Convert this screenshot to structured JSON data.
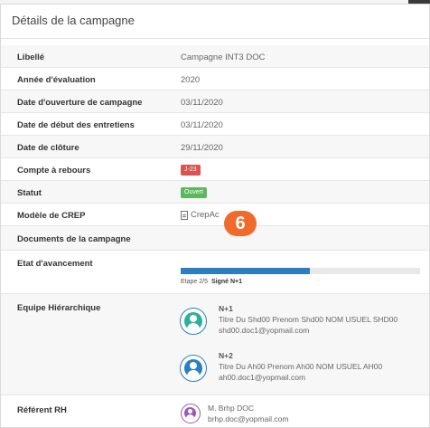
{
  "panel": {
    "title": "Détails de la campagne"
  },
  "rows": {
    "libelle": {
      "label": "Libellé",
      "value": "Campagne INT3 DOC"
    },
    "annee": {
      "label": "Année d'évaluation",
      "value": "2020"
    },
    "ouverture": {
      "label": "Date d'ouverture de campagne",
      "value": "03/11/2020"
    },
    "debut": {
      "label": "Date de début des entretiens",
      "value": "03/11/2020"
    },
    "cloture": {
      "label": "Date de clôture",
      "value": "29/11/2020"
    },
    "compte": {
      "label": "Compte à rebours",
      "badge": "J-23",
      "badge_color": "#d9534f"
    },
    "statut": {
      "label": "Statut",
      "badge": "Ouvert",
      "badge_color": "#5cb85c"
    },
    "modele": {
      "label": "Modèle de CREP",
      "link": "CrepAc",
      "icon": "document-icon"
    },
    "documents": {
      "label": "Documents de la campagne"
    },
    "etat": {
      "label": "Etat d'avancement",
      "progress_fraction": 0.54,
      "step_text": "Etape 2/5",
      "signed_text": "Signé N+1",
      "bar_color": "#2b7fc1"
    },
    "equipe": {
      "label": "Equipe Hiérarchique",
      "members": [
        {
          "role": "N+1",
          "name": "Titre Du Shd00 Prenom Shd00 NOM USUEL SHD00",
          "email": "shd00.doc1@yopmail.com",
          "avatar_color": "#2bb0a0"
        },
        {
          "role": "N+2",
          "name": "Titre Du Ah00 Prenom Ah00 NOM USUEL AH00",
          "email": "ah00.doc1@yopmail.com",
          "avatar_color": "#2b7fc1"
        }
      ]
    },
    "referent": {
      "label": "Référent RH",
      "name": "M. Brhp DOC",
      "email": "brhp.doc@yopmail.com",
      "avatar_color": "#9b59b6"
    }
  },
  "marker": {
    "text": "6",
    "color": "#f06a2c"
  }
}
